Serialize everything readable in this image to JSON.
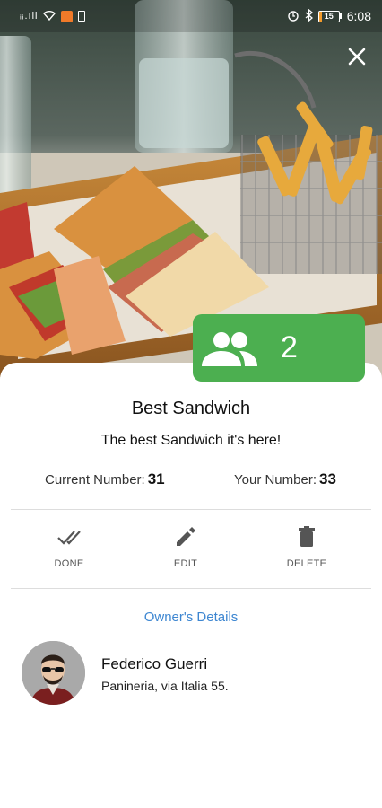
{
  "status_bar": {
    "signal": "ᵢᵢ.ıll",
    "battery_level": 15,
    "battery_label": "15",
    "time": "6:08"
  },
  "header": {
    "close_icon": "close-icon"
  },
  "queue": {
    "people_icon": "people-icon",
    "count": "2",
    "color": "#4caf50"
  },
  "shop": {
    "title": "Best Sandwich",
    "description": "The best Sandwich it's here!"
  },
  "numbers": {
    "current_label": "Current Number:",
    "current_value": "31",
    "yours_label": "Your Number:",
    "yours_value": "33"
  },
  "actions": [
    {
      "label": "DONE",
      "icon": "done-all-icon"
    },
    {
      "label": "EDIT",
      "icon": "pencil-icon"
    },
    {
      "label": "DELETE",
      "icon": "trash-icon"
    }
  ],
  "owner": {
    "link_label": "Owner's Details",
    "link_color": "#3d86d1",
    "name": "Federico Guerri",
    "address": "Panineria, via Italia 55."
  }
}
